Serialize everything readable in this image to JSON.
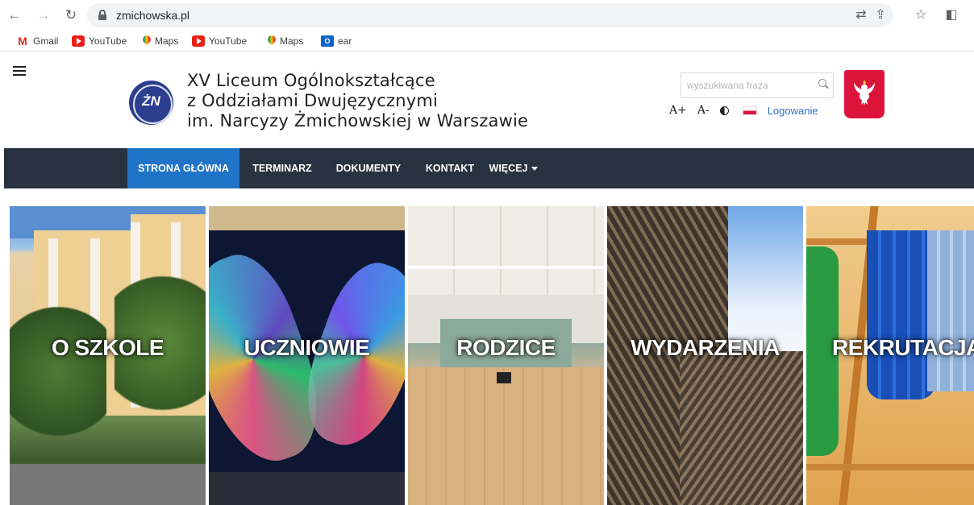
{
  "browser": {
    "url": "zmichowska.pl",
    "bookmarks": [
      {
        "label": "Gmail",
        "icon": "gmail-icon"
      },
      {
        "label": "YouTube",
        "icon": "youtube-icon"
      },
      {
        "label": "Maps",
        "icon": "maps-icon"
      },
      {
        "label": "YouTube",
        "icon": "youtube-icon"
      },
      {
        "label": "Maps",
        "icon": "maps-icon"
      },
      {
        "label": "ear",
        "icon": "outlook-icon"
      }
    ]
  },
  "header": {
    "title_line1": "XV Liceum Ogólnokształcące",
    "title_line2": "z Oddziałami Dwujęzycznymi",
    "title_line3": "im. Narcyzy Żmichowskiej w Warszawie",
    "search_placeholder": "wyszukiwana fraza",
    "font_increase": "A+",
    "font_decrease": "A-",
    "login": "Logowanie"
  },
  "nav": {
    "items": [
      {
        "label": "STRONA GŁÓWNA",
        "active": true
      },
      {
        "label": "TERMINARZ"
      },
      {
        "label": "DOKUMENTY"
      },
      {
        "label": "KONTAKT"
      },
      {
        "label": "WIĘCEJ"
      }
    ]
  },
  "tiles": [
    {
      "label": "O SZKOLE"
    },
    {
      "label": "UCZNIOWIE"
    },
    {
      "label": "RODZICE"
    },
    {
      "label": "WYDARZENIA"
    },
    {
      "label": "REKRUTACJA"
    }
  ],
  "colors": {
    "navbar": "#273341",
    "nav_active": "#1f74c8",
    "link": "#2f6fc2",
    "emblem_red": "#dc143c"
  }
}
